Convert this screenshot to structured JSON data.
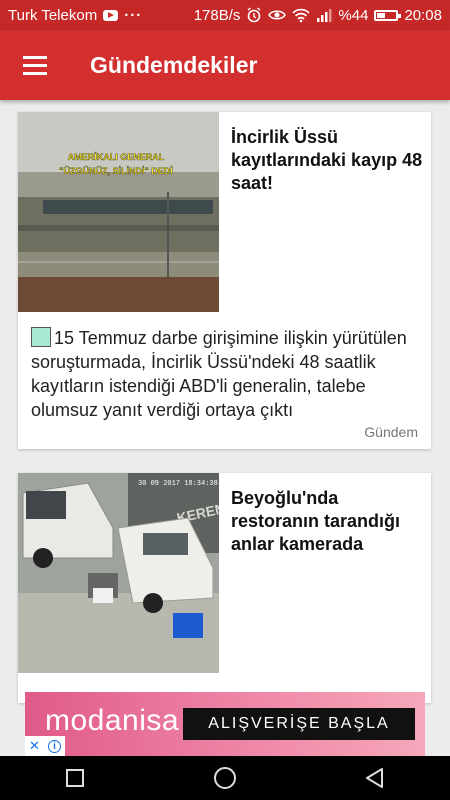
{
  "status_bar": {
    "carrier": "Turk Telekom",
    "speed": "178B/s",
    "battery_percent": "%44",
    "battery_level": 0.44,
    "time": "20:08",
    "icons": [
      "youtube-icon",
      "more-dots-icon",
      "alarm-icon",
      "eye-icon",
      "wifi-icon",
      "signal-icon",
      "battery-icon"
    ]
  },
  "app_bar": {
    "title": "Gündemdekiler",
    "menu_icon": "hamburger-menu-icon",
    "color": "#d32f2f"
  },
  "articles": [
    {
      "headline": "İncirlik Üssü kayıtlarındaki kayıp 48 saat!",
      "image_caption": "AMERİKALI GENERAL \"ÜZGÜNÜZ, SİLİNDİ\" DEDİ",
      "summary": "15 Temmuz darbe girişimine ilişkin yürütülen soruşturmada, İncirlik Üssü'ndeki 48 saatlik kayıtların istendiği ABD'li generalin, talebe olumsuz yanıt verdiği ortaya çıktı",
      "category": "Gündem"
    },
    {
      "headline": "Beyoğlu'nda restoranın tarandığı anlar kamerada",
      "image_timestamp": "30 09 2017 18:34:38",
      "image_sign": "KEREM T"
    }
  ],
  "ad": {
    "brand": "modanisa",
    "cta": "ALIŞVERİŞE BAŞLA",
    "badge_close": "✕",
    "badge_info": "i"
  },
  "nav_bar": {
    "icons": [
      "recents-square-icon",
      "home-circle-icon",
      "back-triangle-icon"
    ]
  }
}
